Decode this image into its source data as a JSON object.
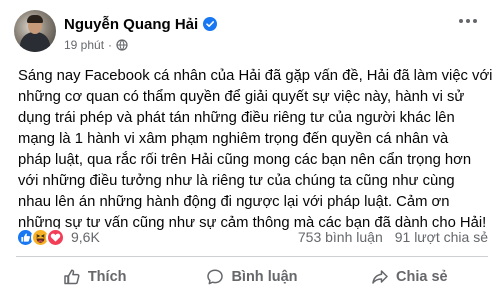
{
  "author": {
    "name": "Nguyễn Quang Hải",
    "verified_color": "#1877f2"
  },
  "post": {
    "time": "19 phút",
    "separator": "·",
    "privacy_icon": "globe-icon",
    "lines": [
      "Sáng nay Facebook cá nhân của Hải đã gặp vấn đề, Hải đã làm việc với",
      "những cơ quan có thẩm quyền để giải quyết sự việc này, hành vi sử",
      "dụng trái phép và phát tán những điều riêng tư của người khác lên",
      "mạng là 1 hành vi xâm phạm nghiêm trọng đến quyền cá nhân và",
      "pháp luật, qua rắc rối trên Hải cũng mong các bạn nên cẩn trọng hơn",
      "với những điều tưởng như là riêng tư của chúng ta cũng như cùng",
      "nhau lên án những hành động đi ngược lại với pháp luật. Cảm ơn",
      "những sự tư vấn cũng như sự cảm thông mà các bạn đã dành cho Hải!"
    ]
  },
  "reactions": {
    "icons": [
      "like-icon",
      "haha-icon",
      "love-icon"
    ],
    "count": "9,6K",
    "comments": "753 bình luận",
    "shares": "91 lượt chia sẻ"
  },
  "actions": {
    "like": "Thích",
    "comment": "Bình luận",
    "share": "Chia sẻ"
  },
  "colors": {
    "like": "#1877f2",
    "haha": "#f7b125",
    "love": "#f33e58",
    "secondary_text": "#65676b"
  }
}
